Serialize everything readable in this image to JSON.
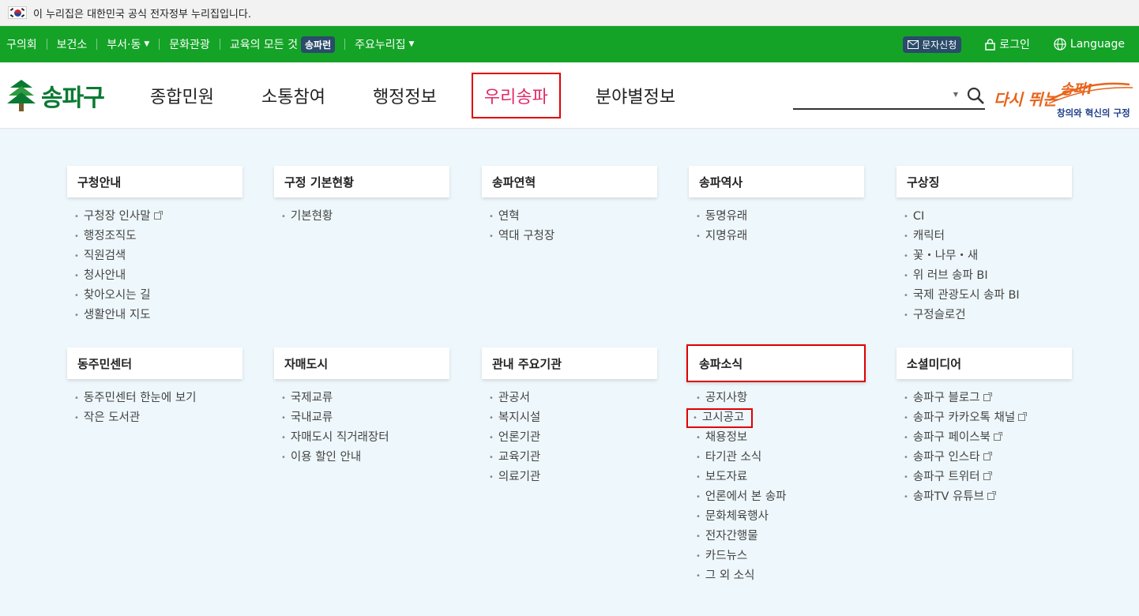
{
  "gov_notice": {
    "text": "이 누리집은 대한민국 공식 전자정부 누리집입니다."
  },
  "util_nav": {
    "links": [
      {
        "label": "구의회",
        "dropdown": false
      },
      {
        "label": "보건소",
        "dropdown": false
      },
      {
        "label": "부서·동",
        "dropdown": true
      },
      {
        "label": "문화관광",
        "dropdown": false
      },
      {
        "label": "교육의 모든 것",
        "badge": "송파런",
        "dropdown": false
      },
      {
        "label": "주요누리집",
        "dropdown": true
      }
    ],
    "message_label": "문자신청",
    "login_label": "로그인",
    "language_label": "Language"
  },
  "header": {
    "logo_text": "송파구",
    "gnb": [
      "종합민원",
      "소통참여",
      "행정정보",
      "우리송파",
      "분야별정보"
    ],
    "active_menu": "우리송파",
    "search": {
      "placeholder": ""
    },
    "slogan": {
      "main": "다시 뛰는",
      "brand": "송파!",
      "sub": "창의와 혁신의 구정"
    }
  },
  "sitemap": {
    "columns": [
      {
        "title": "구청안내",
        "items": [
          {
            "label": "구청장 인사말",
            "ext": true
          },
          {
            "label": "행정조직도"
          },
          {
            "label": "직원검색"
          },
          {
            "label": "청사안내"
          },
          {
            "label": "찾아오시는 길"
          },
          {
            "label": "생활안내 지도"
          }
        ]
      },
      {
        "title": "구정 기본현황",
        "items": [
          {
            "label": "기본현황"
          }
        ]
      },
      {
        "title": "송파연혁",
        "items": [
          {
            "label": "연혁"
          },
          {
            "label": "역대 구청장"
          }
        ]
      },
      {
        "title": "송파역사",
        "items": [
          {
            "label": "동명유래"
          },
          {
            "label": "지명유래"
          }
        ]
      },
      {
        "title": "구상징",
        "items": [
          {
            "label": "CI"
          },
          {
            "label": "캐릭터"
          },
          {
            "label": "꽃・나무・새"
          },
          {
            "label": "위 러브 송파 BI"
          },
          {
            "label": "국제 관광도시 송파 BI"
          },
          {
            "label": "구정슬로건"
          }
        ]
      },
      {
        "title": "동주민센터",
        "items": [
          {
            "label": "동주민센터 한눈에 보기"
          },
          {
            "label": "작은 도서관"
          }
        ]
      },
      {
        "title": "자매도시",
        "items": [
          {
            "label": "국제교류"
          },
          {
            "label": "국내교류"
          },
          {
            "label": "자매도시 직거래장터"
          },
          {
            "label": "이용 할인 안내"
          }
        ]
      },
      {
        "title": "관내 주요기관",
        "items": [
          {
            "label": "관공서"
          },
          {
            "label": "복지시설"
          },
          {
            "label": "언론기관"
          },
          {
            "label": "교육기관"
          },
          {
            "label": "의료기관"
          }
        ]
      },
      {
        "title": "송파소식",
        "highlighted": true,
        "items": [
          {
            "label": "공지사항"
          },
          {
            "label": "고시공고",
            "highlighted": true
          },
          {
            "label": "채용정보"
          },
          {
            "label": "타기관 소식"
          },
          {
            "label": "보도자료"
          },
          {
            "label": "언론에서 본 송파"
          },
          {
            "label": "문화체육행사"
          },
          {
            "label": "전자간행물"
          },
          {
            "label": "카드뉴스"
          },
          {
            "label": "그 외 소식"
          }
        ]
      },
      {
        "title": "소셜미디어",
        "items": [
          {
            "label": "송파구 블로그",
            "ext": true
          },
          {
            "label": "송파구 카카오톡 채널",
            "ext": true
          },
          {
            "label": "송파구 페이스북",
            "ext": true
          },
          {
            "label": "송파구 인스타",
            "ext": true
          },
          {
            "label": "송파구 트위터",
            "ext": true
          },
          {
            "label": "송파TV 유튜브",
            "ext": true
          }
        ]
      }
    ]
  },
  "colors": {
    "green_bar": "#14a327",
    "logo_green": "#0a7a32",
    "active_menu": "#e02a6b",
    "highlight_box": "#e00000",
    "background": "#eef7fb"
  }
}
